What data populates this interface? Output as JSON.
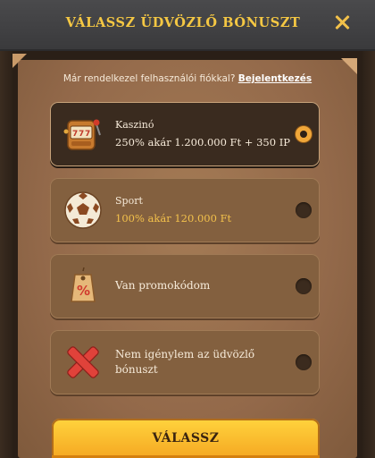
{
  "header": {
    "title": "VÁLASSZ ÜDVÖZLŐ BÓNUSZT"
  },
  "login": {
    "prompt": "Már rendelkezel felhasználói fiókkal?",
    "link": "Bejelentkezés"
  },
  "options": [
    {
      "id": "casino",
      "title": "Kaszinó",
      "subtitle": "250% akár 1.200.000 Ft + 350 IP",
      "icon": "slot-machine-icon",
      "selected": true
    },
    {
      "id": "sport",
      "title": "Sport",
      "subtitle": "100% akár 120.000 Ft",
      "icon": "soccer-ball-icon",
      "selected": false
    },
    {
      "id": "promo",
      "title": "Van promokódom",
      "icon": "price-tag-icon",
      "selected": false
    },
    {
      "id": "none",
      "title": "Nem igénylem az üdvözlő bónuszt",
      "icon": "red-x-icon",
      "selected": false
    }
  ],
  "cta": {
    "label": "VÁLASSZ"
  },
  "colors": {
    "accent": "#f4c743",
    "button_top": "#ffd43d",
    "button_bottom": "#f5a822",
    "panel": "#93694a",
    "selected_option": "#3a2b1f"
  }
}
